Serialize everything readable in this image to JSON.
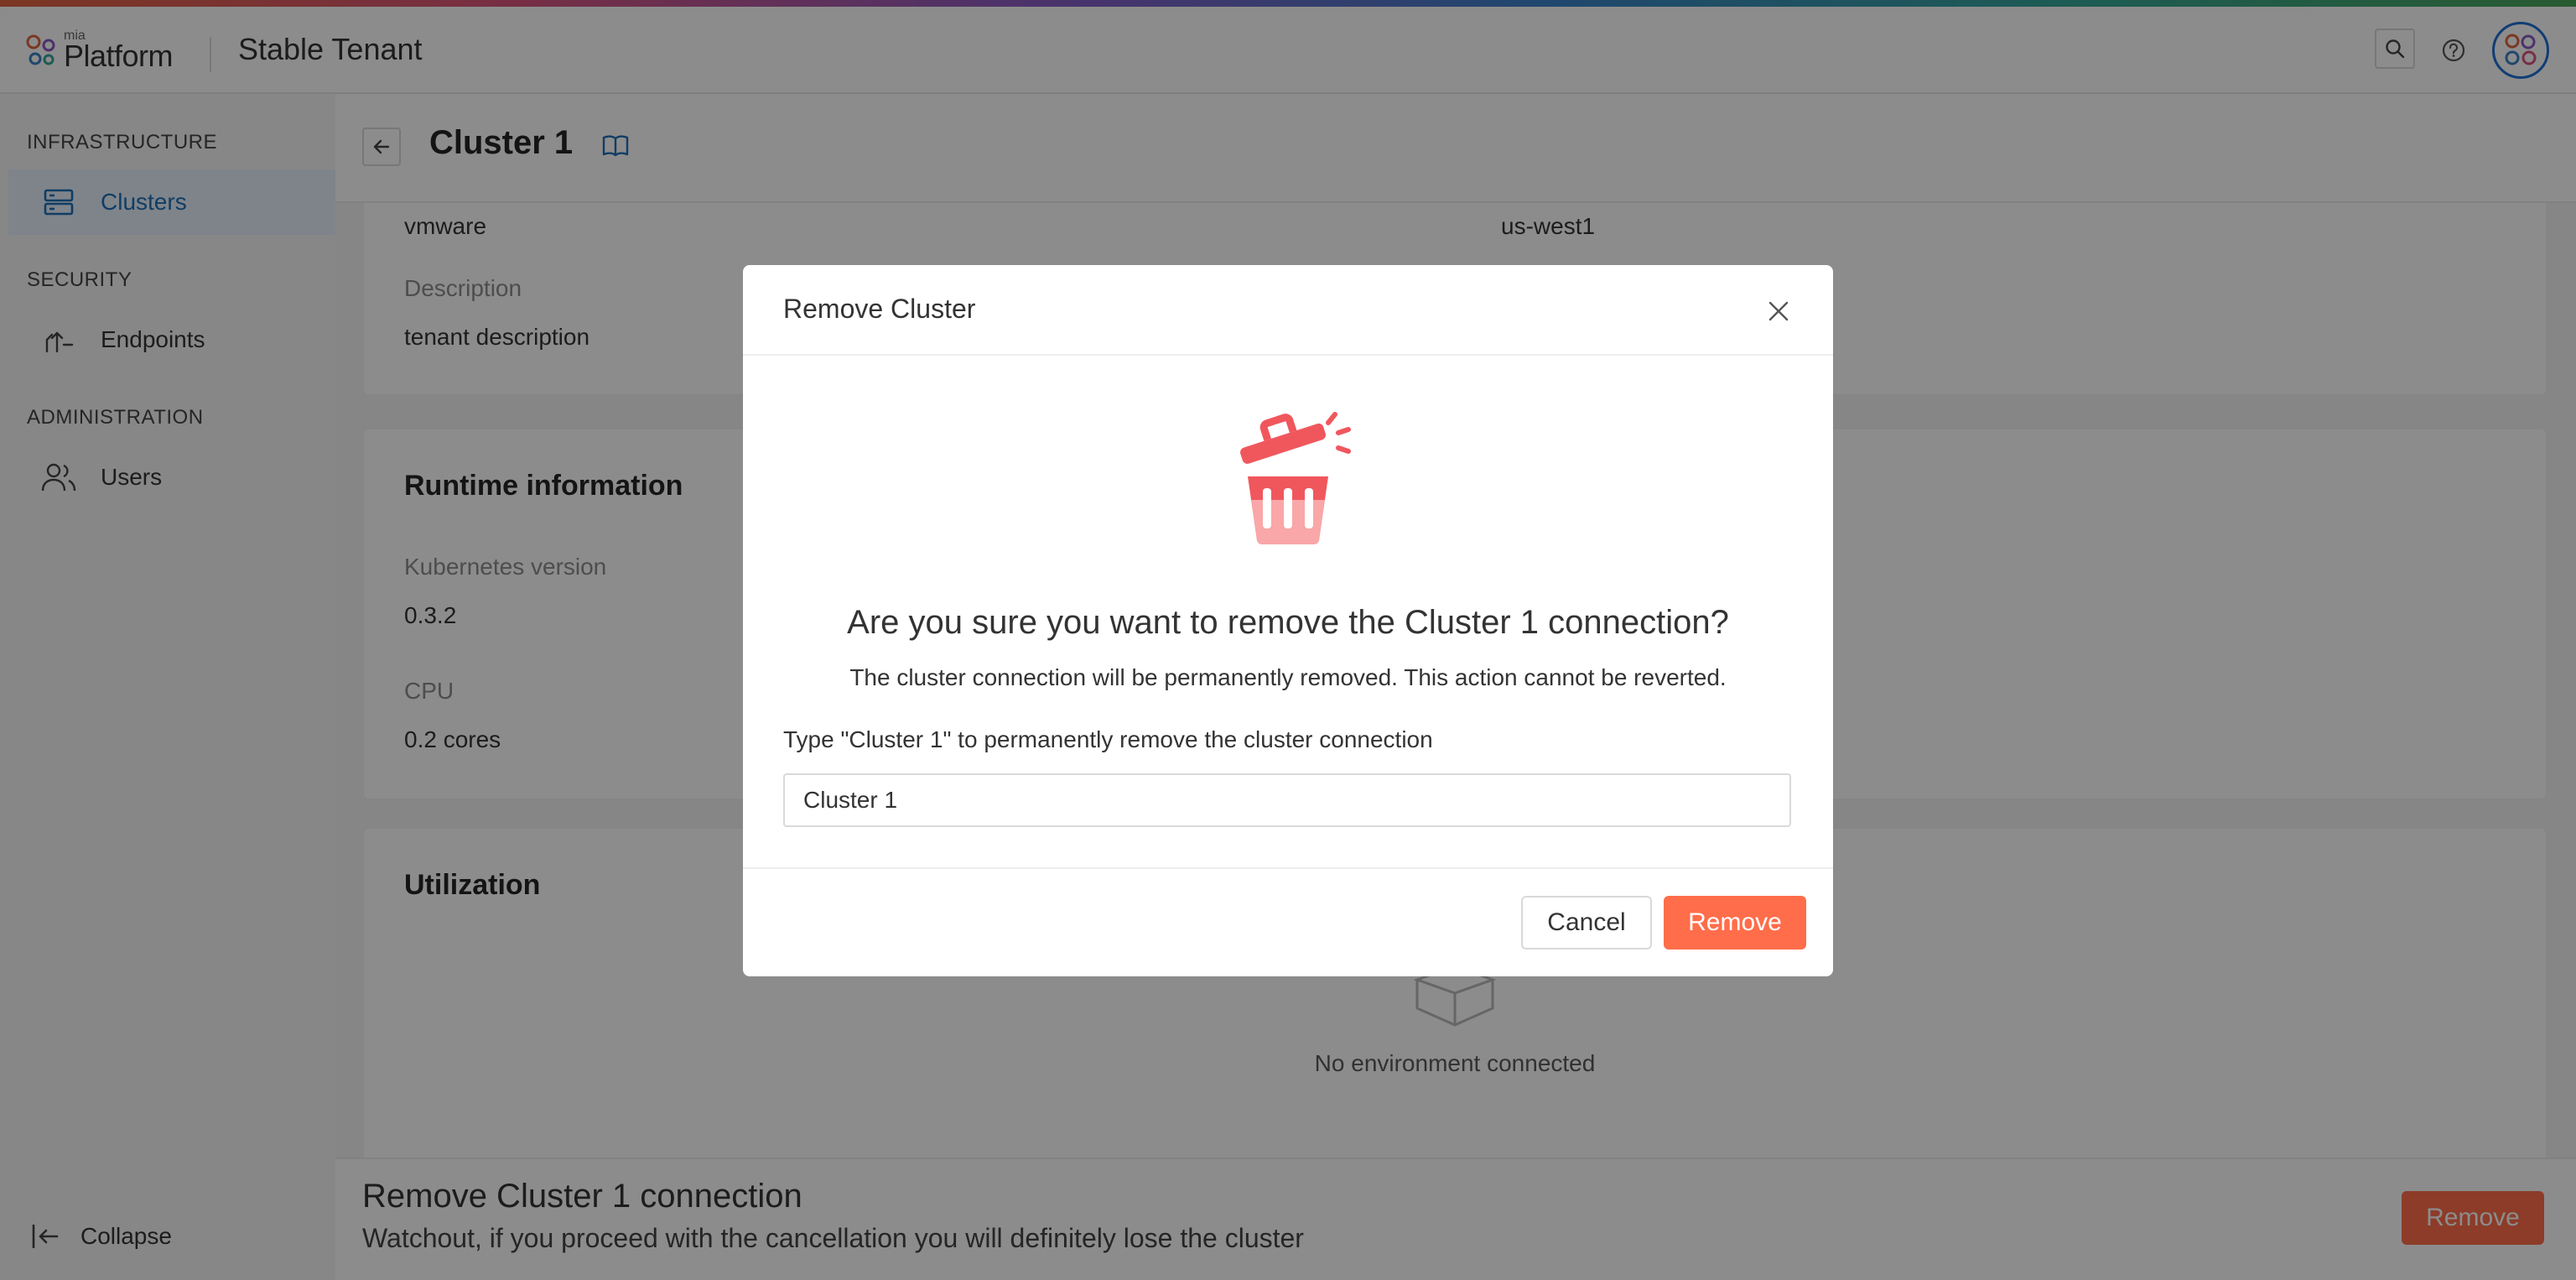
{
  "header": {
    "logo_small": "mia",
    "logo_main": "Platform",
    "tenant_name": "Stable Tenant"
  },
  "sidebar": {
    "sections": [
      {
        "title": "INFRASTRUCTURE",
        "items": [
          {
            "label": "Clusters",
            "icon": "clusters-icon",
            "active": true
          }
        ]
      },
      {
        "title": "SECURITY",
        "items": [
          {
            "label": "Endpoints",
            "icon": "endpoints-icon",
            "active": false
          }
        ]
      },
      {
        "title": "ADMINISTRATION",
        "items": [
          {
            "label": "Users",
            "icon": "users-icon",
            "active": false
          }
        ]
      }
    ],
    "collapse_label": "Collapse"
  },
  "page": {
    "title": "Cluster 1",
    "general": {
      "vendor_value": "vmware",
      "region_value": "us-west1",
      "description_label": "Description",
      "description_value": "tenant description"
    },
    "runtime": {
      "title": "Runtime information",
      "k8s_label": "Kubernetes version",
      "k8s_value": "0.3.2",
      "cpu_label": "CPU",
      "cpu_value": "0.2 cores"
    },
    "utilization": {
      "title": "Utilization",
      "empty_text": "No environment connected"
    },
    "danger": {
      "title": "Remove Cluster 1 connection",
      "subtitle": "Watchout, if you proceed with the cancellation you will definitely lose the cluster",
      "button": "Remove"
    }
  },
  "modal": {
    "title": "Remove Cluster",
    "question": "Are you sure you want to remove the Cluster 1 connection?",
    "description": "The cluster connection will be permanently removed. This action cannot be reverted.",
    "type_label": "Type \"Cluster 1\" to permanently remove the cluster connection",
    "input_value": "Cluster 1",
    "cancel_label": "Cancel",
    "remove_label": "Remove"
  },
  "colors": {
    "primary": "#1f6fb8",
    "danger": "#ff6d4a",
    "trash_dark": "#f0575d",
    "trash_light": "#f9a7a8"
  }
}
